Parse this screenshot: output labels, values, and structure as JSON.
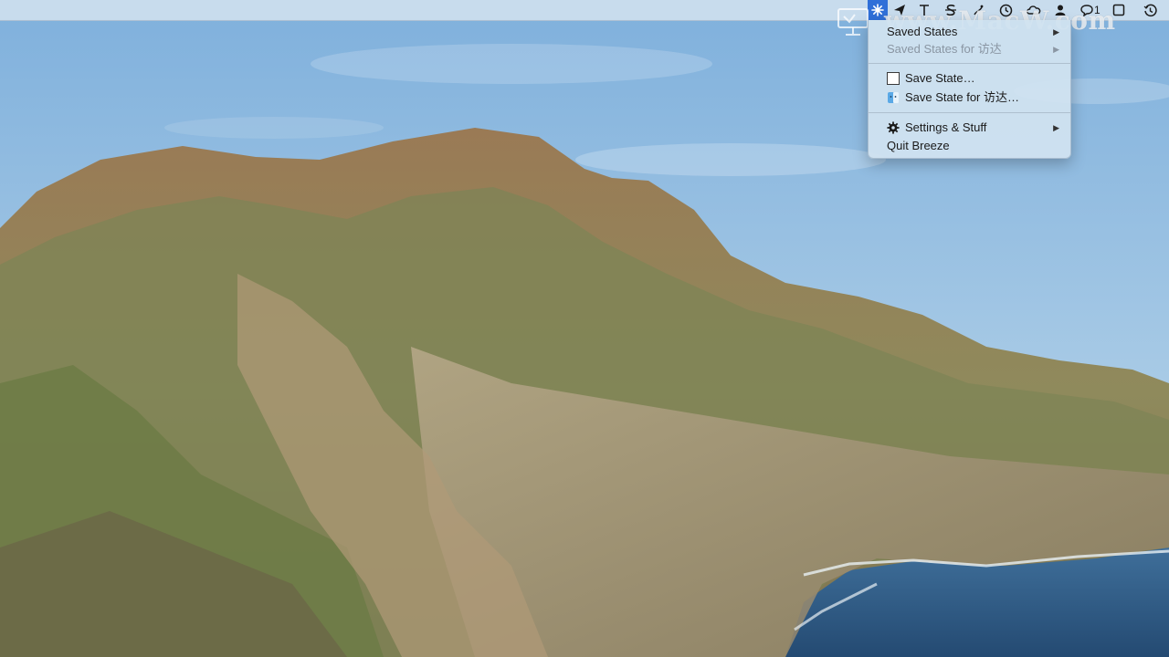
{
  "watermark": {
    "text": "www.MacW.com"
  },
  "menubar": {
    "icons": [
      {
        "name": "breeze-icon",
        "active": true
      },
      {
        "name": "send-icon"
      },
      {
        "name": "text-icon"
      },
      {
        "name": "strikethrough-icon"
      },
      {
        "name": "status-icon"
      },
      {
        "name": "clock-dial-icon"
      },
      {
        "name": "creative-cloud-icon"
      },
      {
        "name": "user-icon"
      },
      {
        "name": "messages-icon"
      },
      {
        "name": "window-icon"
      },
      {
        "name": "time-machine-icon"
      }
    ],
    "messages_count": "1"
  },
  "menu": {
    "items": [
      {
        "label": "Saved States",
        "submenu": true,
        "enabled": true
      },
      {
        "label": "Saved States for 访达",
        "submenu": true,
        "enabled": false
      },
      {
        "label": "Save State…",
        "icon": "window-outline-icon",
        "enabled": true
      },
      {
        "label": "Save State for 访达…",
        "icon": "finder-icon",
        "enabled": true
      },
      {
        "label": "Settings & Stuff",
        "icon": "gear-icon",
        "submenu": true,
        "enabled": true
      },
      {
        "label": "Quit Breeze",
        "enabled": true
      }
    ],
    "submenu_arrow": "▶"
  },
  "colors": {
    "sky": "#8bb8de",
    "ocean": "#2d5a86",
    "menu_highlight": "#2f6fd8"
  }
}
